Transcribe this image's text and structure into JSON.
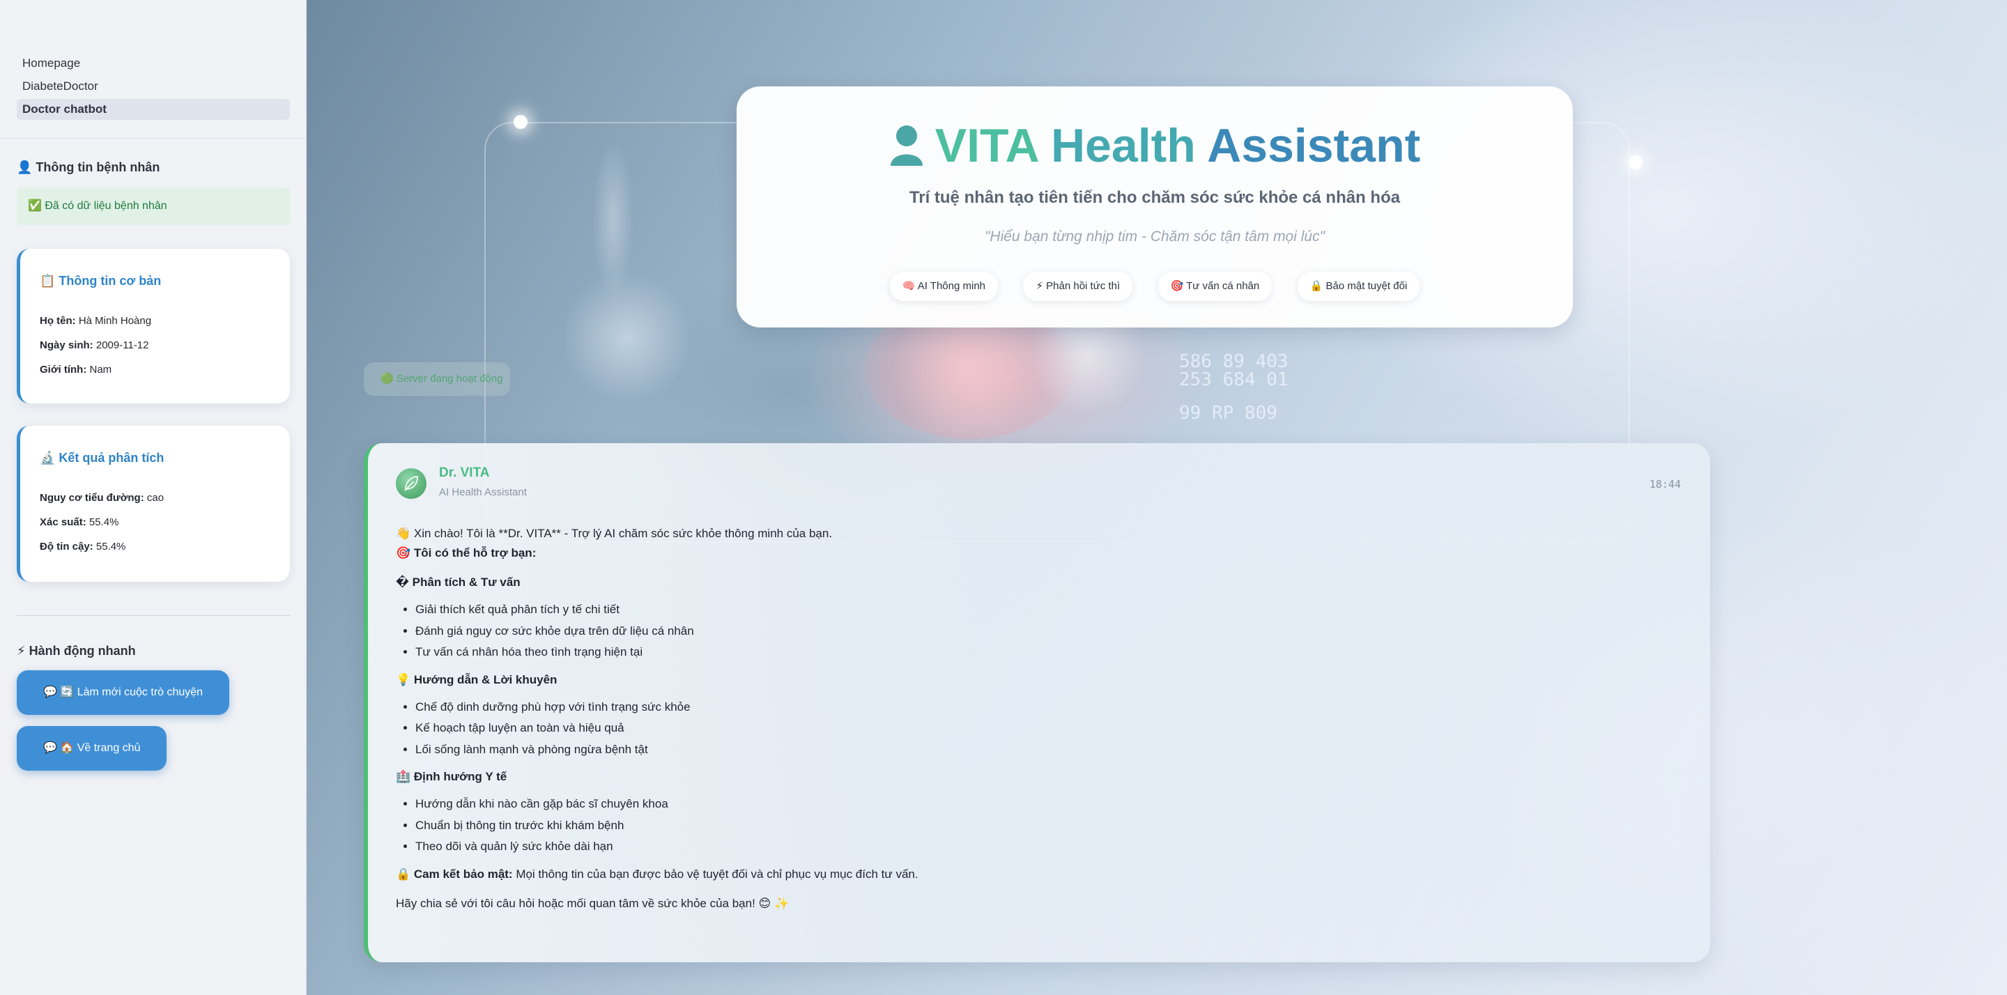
{
  "sidebar": {
    "nav": [
      "Homepage",
      "DiabeteDoctor",
      "Doctor chatbot"
    ],
    "patient_heading": "👤 Thông tin bệnh nhân",
    "patient_status": "✅ Đã có dữ liệu bệnh nhân",
    "basic_card": {
      "title": "📋 Thông tin cơ bản",
      "rows": [
        {
          "label": "Họ tên:",
          "value": "Hà Minh Hoàng"
        },
        {
          "label": "Ngày sinh:",
          "value": "2009-11-12"
        },
        {
          "label": "Giới tính:",
          "value": "Nam"
        }
      ]
    },
    "result_card": {
      "title": "🔬 Kết quả phân tích",
      "rows": [
        {
          "label": "Nguy cơ tiểu đường:",
          "value": "cao"
        },
        {
          "label": "Xác suất:",
          "value": "55.4%"
        },
        {
          "label": "Độ tin cậy:",
          "value": "55.4%"
        }
      ]
    },
    "quick_heading": "⚡ Hành động nhanh",
    "quick_actions": [
      "💬  🔄 Làm mới cuộc trò chuyện",
      "💬  🏠 Về trang chủ"
    ]
  },
  "hero": {
    "title_words": [
      "VITA",
      "Health",
      "Assistant"
    ],
    "subtitle": "Trí tuệ nhân tạo tiên tiến cho chăm sóc sức khỏe cá nhân hóa",
    "quote": "\"Hiểu bạn từng nhịp tim - Chăm sóc tận tâm mọi lúc\"",
    "chips": [
      "🧠  AI Thông minh",
      "⚡  Phản hồi tức thì",
      "🎯  Tư vấn cá nhân",
      "🔒  Bảo mật tuyệt đối"
    ]
  },
  "server_status": "🟢 Server đang hoạt động",
  "background_numbers": [
    "586 89 403",
    "253 684 01",
    "99 RP 809"
  ],
  "chat": {
    "bot_name": "Dr. VITA",
    "bot_role": "AI Health Assistant",
    "time": "18:44",
    "greeting": "👋 Xin chào! Tôi là **Dr. VITA** - Trợ lý AI chăm sóc sức khỏe thông minh của bạn.",
    "support_heading": "🎯 Tôi có thể hỗ trợ bạn:",
    "sections": [
      {
        "title": "� Phân tích & Tư vấn",
        "items": [
          "Giải thích kết quả phân tích y tế chi tiết",
          "Đánh giá nguy cơ sức khỏe dựa trên dữ liệu cá nhân",
          "Tư vấn cá nhân hóa theo tình trạng hiện tại"
        ]
      },
      {
        "title": "💡 Hướng dẫn & Lời khuyên",
        "items": [
          "Chế độ dinh dưỡng phù hợp với tình trạng sức khỏe",
          "Kế hoạch tập luyện an toàn và hiệu quả",
          "Lối sống lành mạnh và phòng ngừa bệnh tật"
        ]
      },
      {
        "title": "🏥 Định hướng Y tế",
        "items": [
          "Hướng dẫn khi nào cần gặp bác sĩ chuyên khoa",
          "Chuẩn bị thông tin trước khi khám bệnh",
          "Theo dõi và quản lý sức khỏe dài hạn"
        ]
      }
    ],
    "commit_label": "🔒 Cam kết bảo mật:",
    "commit_text": " Mọi thông tin của bạn được bảo vệ tuyệt đối và chỉ phục vụ mục đích tư vấn.",
    "closing": "Hãy chia sẻ với tôi câu hỏi hoặc mối quan tâm về sức khỏe của bạn! 😊 ✨"
  },
  "colors": {
    "accent_blue": "#3f8fd6",
    "accent_green": "#4cbf74",
    "title_gradient": [
      "#4cbfa0",
      "#3b89b8"
    ]
  }
}
